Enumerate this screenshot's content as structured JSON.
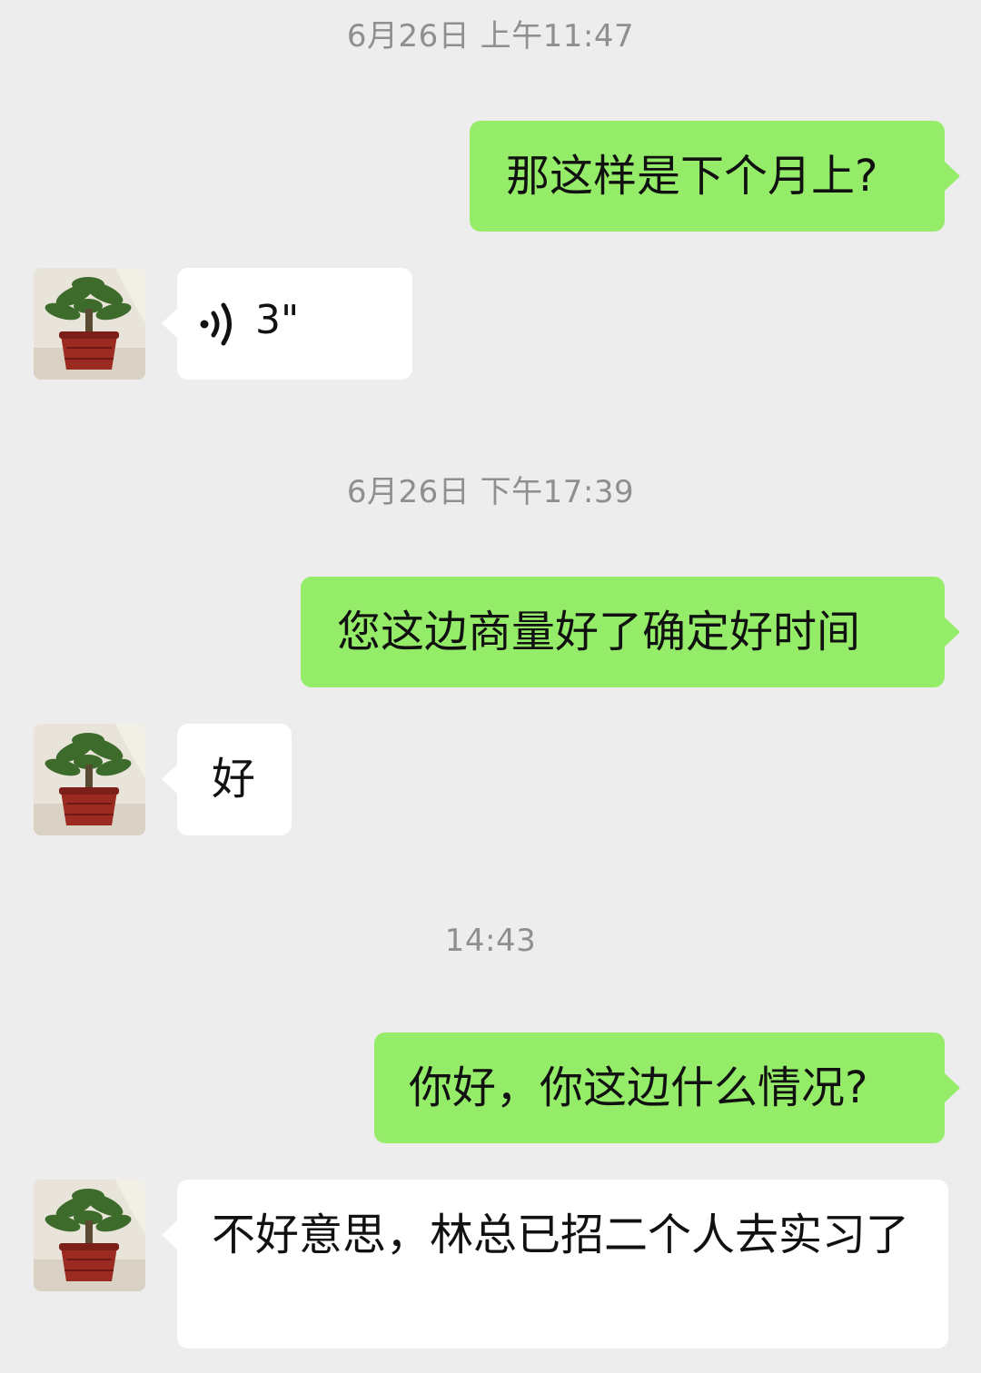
{
  "colors": {
    "background": "#ededed",
    "sent_bubble": "#95ec69",
    "received_bubble": "#ffffff",
    "timestamp_text": "#8f8f8f"
  },
  "chat": {
    "timestamps": [
      "6月26日 上午11:47",
      "6月26日 下午17:39",
      "14:43"
    ],
    "messages": [
      {
        "side": "sent",
        "type": "text",
        "text": "那这样是下个月上?"
      },
      {
        "side": "received",
        "type": "voice",
        "avatar_icon": "potted-plant-avatar",
        "voice_icon": "voice-wave-icon",
        "duration": "3\""
      },
      {
        "side": "sent",
        "type": "text",
        "text": "您这边商量好了确定好时间"
      },
      {
        "side": "received",
        "type": "text",
        "avatar_icon": "potted-plant-avatar",
        "text": "好"
      },
      {
        "side": "sent",
        "type": "text",
        "text": "你好，你这边什么情况?"
      },
      {
        "side": "received",
        "type": "text",
        "avatar_icon": "potted-plant-avatar",
        "text": "不好意思，林总已招二个人去实习了"
      }
    ]
  }
}
